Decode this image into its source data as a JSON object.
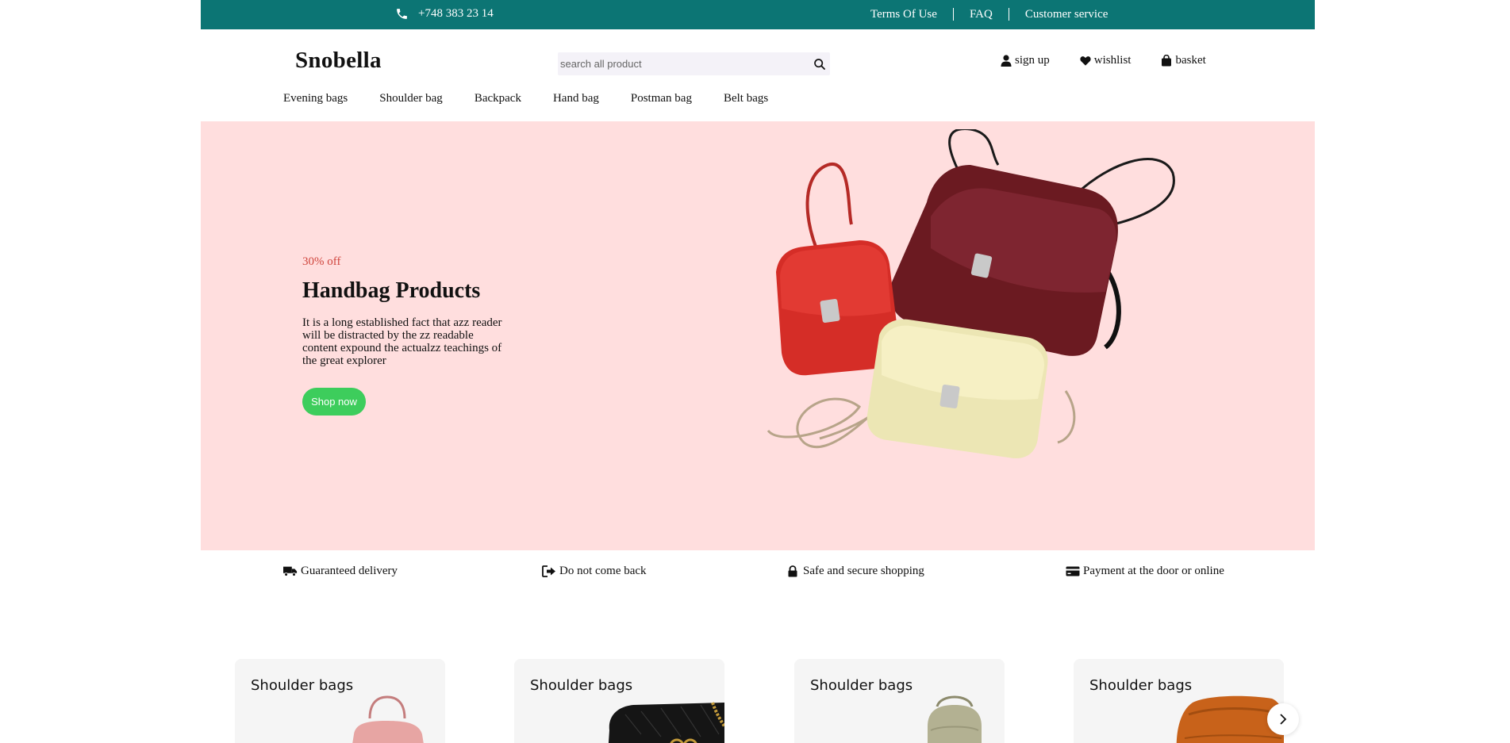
{
  "topbar": {
    "phone": "+748 383 23 14",
    "links": [
      "Terms Of Use",
      "FAQ",
      "Customer service"
    ]
  },
  "header": {
    "logo": "Snobella",
    "search_placeholder": "search all product",
    "actions": [
      {
        "label": "sign up",
        "icon": "user-icon"
      },
      {
        "label": "wishlist",
        "icon": "heart-icon"
      },
      {
        "label": "basket",
        "icon": "bag-icon"
      }
    ]
  },
  "nav": [
    "Evening bags",
    "Shoulder bag",
    "Backpack",
    "Hand bag",
    "Postman bag",
    "Belt bags"
  ],
  "hero": {
    "discount": "30% off",
    "title": "Handbag Products",
    "text": "It is a long established fact that azz reader will be distracted by the zz readable content expound the actualzz teachings of the great explorer",
    "button": "Shop now"
  },
  "features": [
    {
      "label": "Guaranteed delivery",
      "icon": "truck-icon"
    },
    {
      "label": "Do not come back",
      "icon": "return-icon"
    },
    {
      "label": "Safe and secure shopping",
      "icon": "lock-icon"
    },
    {
      "label": "Payment at the door or online",
      "icon": "credit-card-icon"
    }
  ],
  "categories": [
    {
      "title": "Shoulder bags"
    },
    {
      "title": "Shoulder bags"
    },
    {
      "title": "Shoulder bags"
    },
    {
      "title": "Shoulder bags"
    }
  ],
  "colors": {
    "topbar": "#0c7574",
    "hero_bg": "#ffdede",
    "accent_red": "#d0453d",
    "button_green": "#3dcd5c"
  }
}
